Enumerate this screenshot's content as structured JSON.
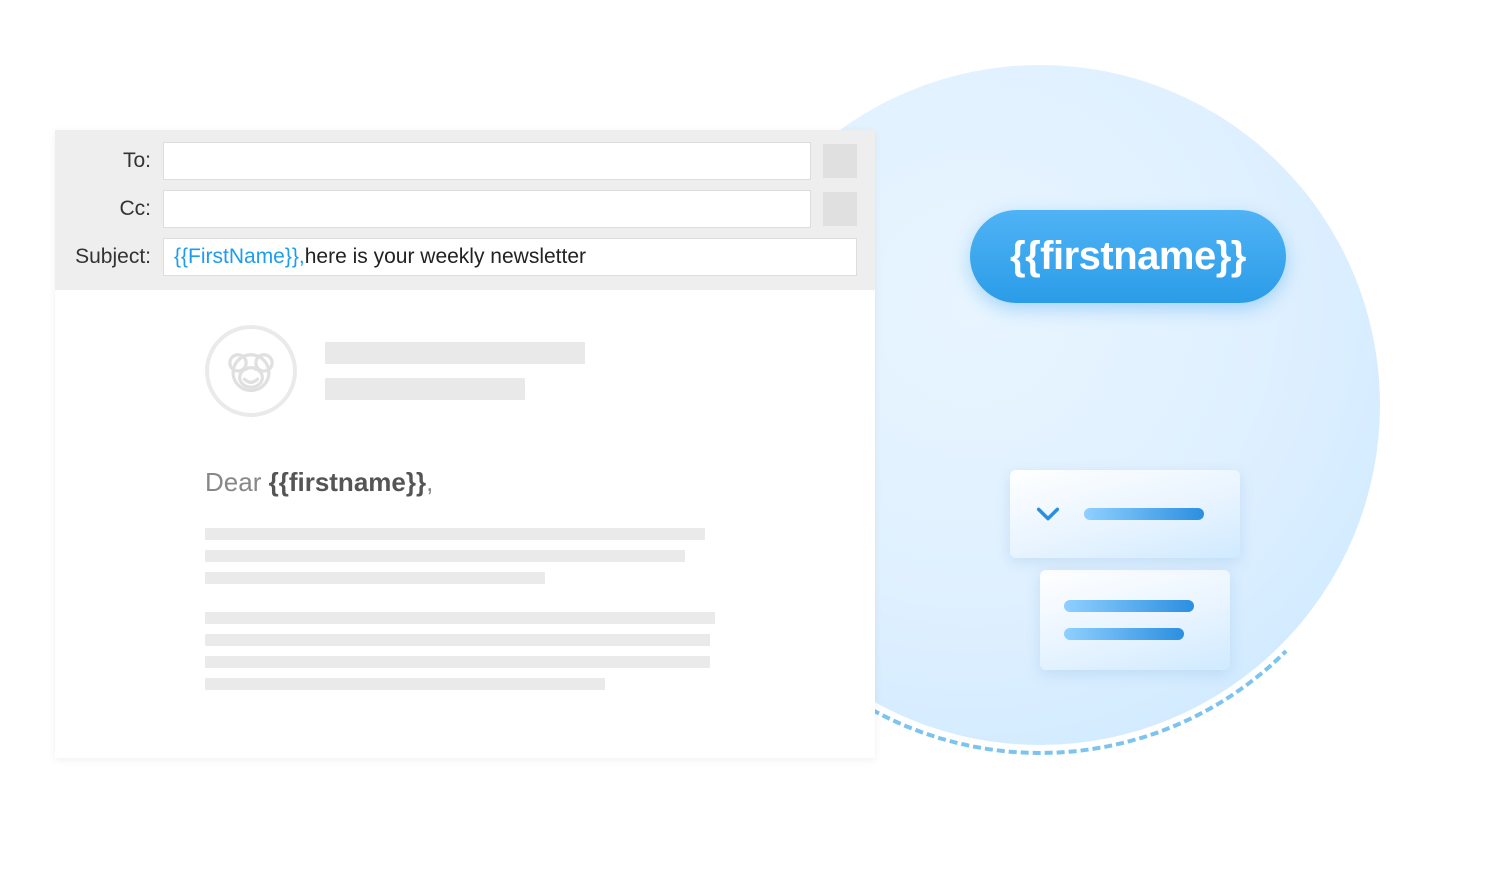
{
  "email": {
    "labels": {
      "to": "To:",
      "cc": "Cc:",
      "subject": "Subject:"
    },
    "to_value": "",
    "cc_value": "",
    "subject_token": "{{FirstName}},",
    "subject_rest": " here is your weekly newsletter"
  },
  "body": {
    "greeting_prefix": "Dear ",
    "greeting_token": "{{firstname}}",
    "greeting_suffix": ","
  },
  "pill": {
    "text": "{{firstname}}"
  },
  "colors": {
    "accent": "#2b9ce8",
    "token": "#1e9cf0",
    "placeholder": "#e9e9e9"
  }
}
